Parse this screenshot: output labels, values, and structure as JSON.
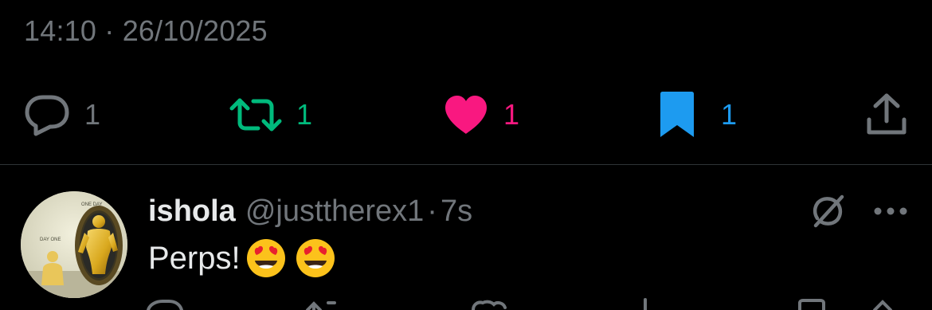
{
  "post": {
    "time": "14:10",
    "separator": "·",
    "date": "26/10/2025"
  },
  "actions": {
    "reply": {
      "icon": "reply-icon",
      "count": "1",
      "color": "#71767b"
    },
    "repost": {
      "icon": "repost-icon",
      "count": "1",
      "color": "#00ba7c"
    },
    "like": {
      "icon": "heart-icon",
      "count": "1",
      "color": "#f91880"
    },
    "bookmark": {
      "icon": "bookmark-icon",
      "count": "1",
      "color": "#1d9bf0"
    },
    "share": {
      "icon": "share-icon"
    }
  },
  "reply_post": {
    "author_name": "ishola",
    "author_handle": "@justtherex1",
    "separator": "·",
    "time_ago": "7s",
    "text": "Perps!",
    "emojis": [
      "😍",
      "😍"
    ],
    "avatar_text": {
      "top": "ONE DAY",
      "left": "DAY ONE"
    }
  },
  "theme": {
    "background": "#000000",
    "primary_text": "#e7e9ea",
    "secondary_text": "#71767b",
    "divider": "#2f3336"
  }
}
